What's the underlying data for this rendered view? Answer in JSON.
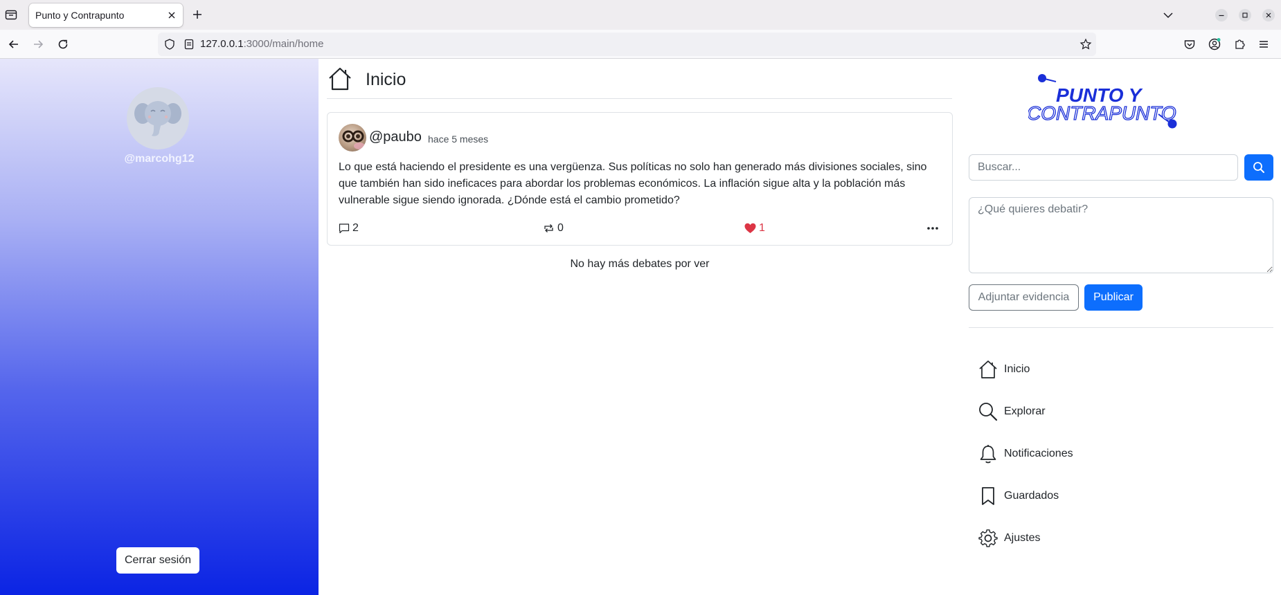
{
  "browser": {
    "tab_title": "Punto y Contrapunto",
    "url_host": "127.0.0.1",
    "url_path": ":3000/main/home"
  },
  "left_sidebar": {
    "username": "@marcohg12",
    "logout_label": "Cerrar sesión"
  },
  "main": {
    "title": "Inicio",
    "posts": [
      {
        "user": "@paubo",
        "time": "hace 5 meses",
        "body": "Lo que está haciendo el presidente es una vergüenza. Sus políticas no solo han generado más divisiones sociales, sino que también han sido ineficaces para abordar los problemas económicos. La inflación sigue alta y la población más vulnerable sigue siendo ignorada. ¿Dónde está el cambio prometido?",
        "comments": "2",
        "reposts": "0",
        "likes": "1"
      }
    ],
    "end_message": "No hay más debates por ver"
  },
  "right_sidebar": {
    "logo_line1": "PUNTO Y",
    "logo_line2": "CONTRAPUNTO",
    "search_placeholder": "Buscar...",
    "debate_placeholder": "¿Qué quieres debatir?",
    "attach_label": "Adjuntar evidencia",
    "publish_label": "Publicar",
    "nav": [
      {
        "label": "Inicio",
        "icon": "house-icon"
      },
      {
        "label": "Explorar",
        "icon": "search-icon"
      },
      {
        "label": "Notificaciones",
        "icon": "bell-icon"
      },
      {
        "label": "Guardados",
        "icon": "bookmark-icon"
      },
      {
        "label": "Ajustes",
        "icon": "gear-icon"
      }
    ]
  },
  "colors": {
    "primary": "#0d6efd",
    "like": "#dc3545",
    "sidebar_top": "#e6e6fb",
    "sidebar_bottom": "#0b24e4",
    "logo_blue": "#1a2fd8"
  }
}
